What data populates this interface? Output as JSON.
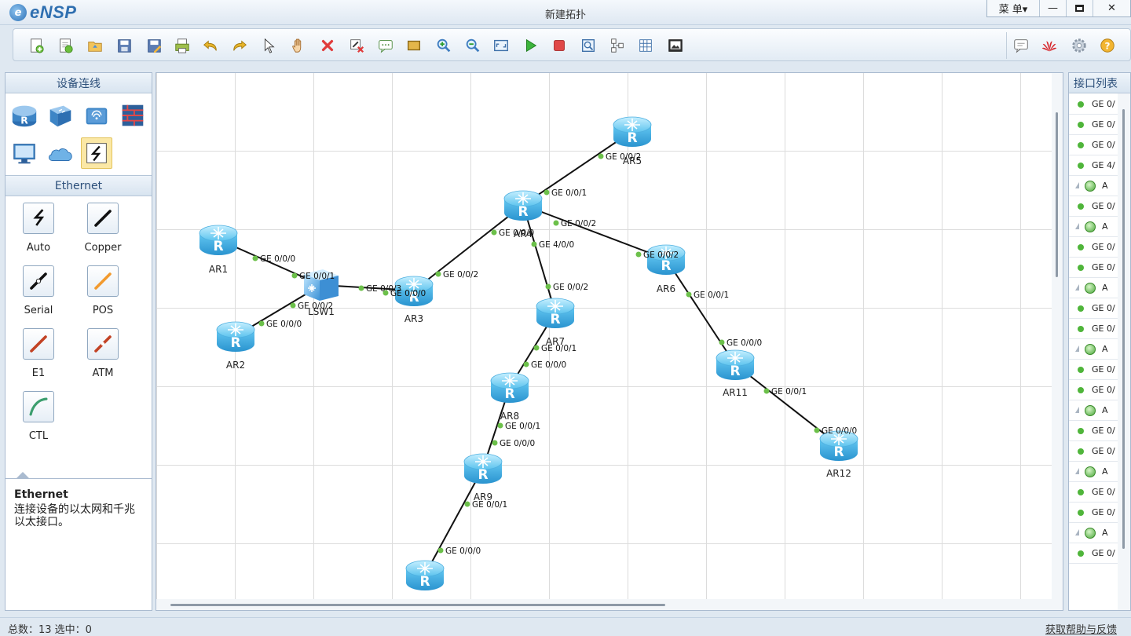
{
  "app": {
    "logo_text": "eNSP",
    "window_title": "新建拓扑",
    "menu_label": "菜 单▾"
  },
  "toolbar": {
    "items": [
      {
        "name": "new-topology-button",
        "icon": "new-file-icon"
      },
      {
        "name": "new-example-button",
        "icon": "new-example-icon"
      },
      {
        "name": "open-button",
        "icon": "open-folder-icon"
      },
      {
        "name": "save-button",
        "icon": "save-icon"
      },
      {
        "name": "save-as-button",
        "icon": "save-as-icon"
      },
      {
        "name": "print-button",
        "icon": "print-icon"
      },
      {
        "name": "undo-button",
        "icon": "undo-icon"
      },
      {
        "name": "redo-button",
        "icon": "redo-icon"
      },
      {
        "name": "select-button",
        "icon": "pointer-icon"
      },
      {
        "name": "pan-button",
        "icon": "hand-icon"
      },
      {
        "name": "delete-button",
        "icon": "delete-icon"
      },
      {
        "name": "delete-all-links-button",
        "icon": "delete-links-icon"
      },
      {
        "name": "add-note-button",
        "icon": "note-icon"
      },
      {
        "name": "add-shape-button",
        "icon": "rectangle-icon"
      },
      {
        "name": "zoom-in-button",
        "icon": "zoom-in-icon"
      },
      {
        "name": "zoom-out-button",
        "icon": "zoom-out-icon"
      },
      {
        "name": "fit-view-button",
        "icon": "fit-view-icon"
      },
      {
        "name": "start-device-button",
        "icon": "play-icon"
      },
      {
        "name": "stop-device-button",
        "icon": "stop-icon"
      },
      {
        "name": "capture-button",
        "icon": "capture-icon"
      },
      {
        "name": "topology-button",
        "icon": "topology-icon"
      },
      {
        "name": "grid-button",
        "icon": "grid-icon"
      },
      {
        "name": "screenshot-button",
        "icon": "screenshot-icon"
      }
    ],
    "right_items": [
      {
        "name": "chat-button",
        "icon": "chat-icon"
      },
      {
        "name": "huawei-button",
        "icon": "huawei-logo-icon"
      },
      {
        "name": "settings-button",
        "icon": "gear-icon"
      },
      {
        "name": "help-button",
        "icon": "help-icon"
      }
    ]
  },
  "left_panel": {
    "devices_title": "设备连线",
    "device_categories": [
      {
        "name": "router",
        "icon": "router-icon"
      },
      {
        "name": "switch",
        "icon": "switch-icon"
      },
      {
        "name": "wlan",
        "icon": "wireless-icon"
      },
      {
        "name": "firewall",
        "icon": "firewall-icon"
      },
      {
        "name": "terminal",
        "icon": "pc-icon"
      },
      {
        "name": "cloud",
        "icon": "cloud-icon"
      },
      {
        "name": "link",
        "icon": "link-icon",
        "selected": true
      }
    ],
    "cables_title": "Ethernet",
    "cables": [
      {
        "label": "Auto",
        "icon": "auto-cable-icon"
      },
      {
        "label": "Copper",
        "icon": "copper-cable-icon"
      },
      {
        "label": "Serial",
        "icon": "serial-cable-icon"
      },
      {
        "label": "POS",
        "icon": "pos-cable-icon"
      },
      {
        "label": "E1",
        "icon": "e1-cable-icon"
      },
      {
        "label": "ATM",
        "icon": "atm-cable-icon"
      },
      {
        "label": "CTL",
        "icon": "ctl-cable-icon"
      }
    ],
    "description": {
      "title": "Ethernet",
      "text": "连接设备的以太网和千兆以太接口。"
    }
  },
  "topology": {
    "nodes": [
      {
        "id": "AR1",
        "label": "AR1",
        "type": "router"
      },
      {
        "id": "AR2",
        "label": "AR2",
        "type": "router"
      },
      {
        "id": "LSW1",
        "label": "LSW1",
        "type": "switch"
      },
      {
        "id": "AR3",
        "label": "AR3",
        "type": "router"
      },
      {
        "id": "AR4",
        "label": "AR4",
        "type": "router"
      },
      {
        "id": "AR5",
        "label": "AR5",
        "type": "router"
      },
      {
        "id": "AR6",
        "label": "AR6",
        "type": "router"
      },
      {
        "id": "AR7",
        "label": "AR7",
        "type": "router"
      },
      {
        "id": "AR8",
        "label": "AR8",
        "type": "router"
      },
      {
        "id": "AR9",
        "label": "AR9",
        "type": "router"
      },
      {
        "id": "AR10",
        "label": "",
        "type": "router"
      },
      {
        "id": "AR11",
        "label": "AR11",
        "type": "router"
      },
      {
        "id": "AR12",
        "label": "AR12",
        "type": "router"
      }
    ],
    "links": [
      {
        "from": "AR1",
        "to": "LSW1",
        "from_port": "GE 0/0/0",
        "to_port": "GE 0/0/1"
      },
      {
        "from": "AR2",
        "to": "LSW1",
        "from_port": "GE 0/0/0",
        "to_port": "GE 0/0/2"
      },
      {
        "from": "LSW1",
        "to": "AR3",
        "from_port": "GE 0/0/3",
        "to_port": "GE 0/0/0"
      },
      {
        "from": "AR3",
        "to": "AR4",
        "from_port": "GE 0/0/2",
        "to_port": "GE 0/0/0"
      },
      {
        "from": "AR4",
        "to": "AR5",
        "from_port": "GE 0/0/1",
        "to_port": "GE 0/0/2"
      },
      {
        "from": "AR4",
        "to": "AR6",
        "from_port": "GE 0/0/2",
        "to_port": "GE 0/0/2"
      },
      {
        "from": "AR4",
        "to": "AR7",
        "from_port": "GE 4/0/0",
        "to_port": "GE 0/0/2"
      },
      {
        "from": "AR7",
        "to": "AR8",
        "from_port": "GE 0/0/1",
        "to_port": "GE 0/0/0"
      },
      {
        "from": "AR8",
        "to": "AR9",
        "from_port": "GE 0/0/1",
        "to_port": "GE 0/0/0"
      },
      {
        "from": "AR9",
        "to": "AR10",
        "from_port": "GE 0/0/1",
        "to_port": "GE 0/0/0"
      },
      {
        "from": "AR6",
        "to": "AR11",
        "from_port": "GE 0/0/1",
        "to_port": "GE 0/0/0"
      },
      {
        "from": "AR11",
        "to": "AR12",
        "from_port": "GE 0/0/1",
        "to_port": "GE 0/0/0"
      }
    ]
  },
  "right_panel": {
    "title": "接口列表",
    "rows": [
      {
        "kind": "port",
        "text": "GE 0/"
      },
      {
        "kind": "port",
        "text": "GE 0/"
      },
      {
        "kind": "port",
        "text": "GE 0/"
      },
      {
        "kind": "port",
        "text": "GE 4/"
      },
      {
        "kind": "device",
        "text": "A"
      },
      {
        "kind": "port",
        "text": "GE 0/"
      },
      {
        "kind": "device",
        "text": "A"
      },
      {
        "kind": "port",
        "text": "GE 0/"
      },
      {
        "kind": "port",
        "text": "GE 0/"
      },
      {
        "kind": "device",
        "text": "A"
      },
      {
        "kind": "port",
        "text": "GE 0/"
      },
      {
        "kind": "port",
        "text": "GE 0/"
      },
      {
        "kind": "device",
        "text": "A"
      },
      {
        "kind": "port",
        "text": "GE 0/"
      },
      {
        "kind": "port",
        "text": "GE 0/"
      },
      {
        "kind": "device",
        "text": "A"
      },
      {
        "kind": "port",
        "text": "GE 0/"
      },
      {
        "kind": "port",
        "text": "GE 0/"
      },
      {
        "kind": "device",
        "text": "A"
      },
      {
        "kind": "port",
        "text": "GE 0/"
      },
      {
        "kind": "port",
        "text": "GE 0/"
      },
      {
        "kind": "device",
        "text": "A"
      },
      {
        "kind": "port",
        "text": "GE 0/"
      }
    ]
  },
  "status": {
    "text": "总数：13  选中：0",
    "feedback": "获取帮助与反馈"
  },
  "colors": {
    "accent": "#2f6fb0",
    "link": "#111111",
    "port_dot": "#6cc04a",
    "router": "#5cc3ee"
  }
}
